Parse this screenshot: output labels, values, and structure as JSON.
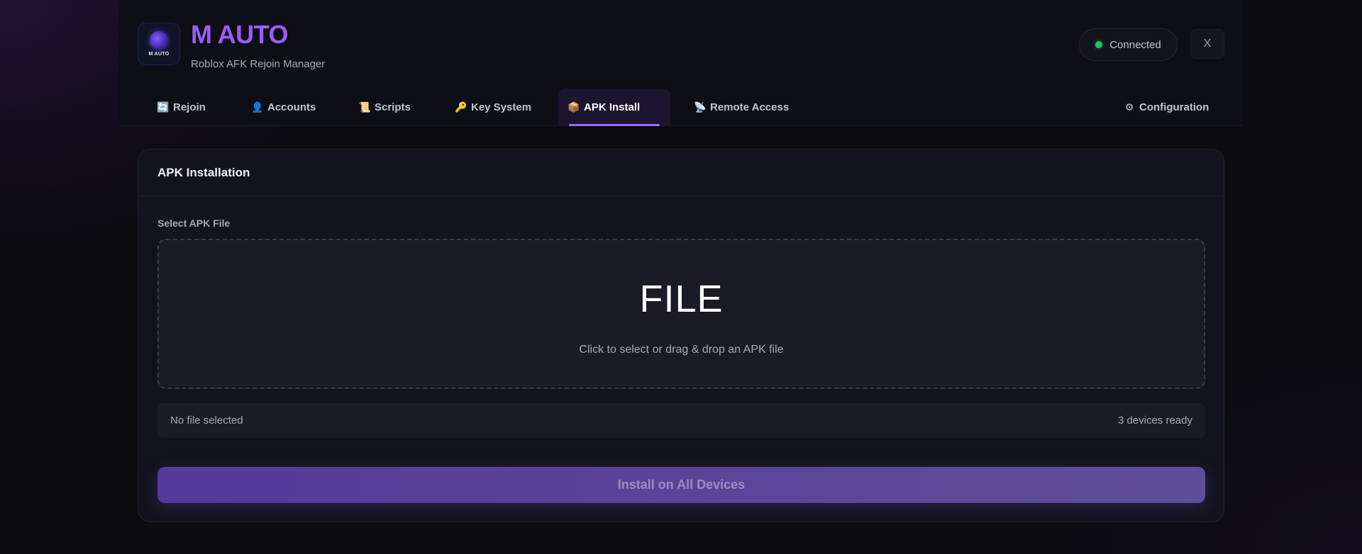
{
  "app": {
    "logo_text": "M AUTO",
    "title": "M AUTO",
    "subtitle": "Roblox AFK Rejoin Manager"
  },
  "status": {
    "label": "Connected",
    "color": "#22c55e"
  },
  "window": {
    "close_label": "X"
  },
  "tabs": [
    {
      "label": "Rejoin",
      "icon": "refresh-icon",
      "glyph": "🔄",
      "active": false
    },
    {
      "label": "Accounts",
      "icon": "user-icon",
      "glyph": "👤",
      "active": false
    },
    {
      "label": "Scripts",
      "icon": "scroll-icon",
      "glyph": "📜",
      "active": false
    },
    {
      "label": "Key System",
      "icon": "key-icon",
      "glyph": "🔑",
      "active": false
    },
    {
      "label": "APK Install",
      "icon": "package-icon",
      "glyph": "📦",
      "active": true
    },
    {
      "label": "Remote Access",
      "icon": "satellite-icon",
      "glyph": "📡",
      "active": false
    },
    {
      "label": "Configuration",
      "icon": "gear-icon",
      "glyph": "⚙",
      "active": false
    }
  ],
  "panel": {
    "title": "APK Installation",
    "field_label": "Select APK File",
    "dropzone_title": "FILE",
    "dropzone_hint": "Click to select or drag & drop an APK file",
    "file_status": "No file selected",
    "devices_status": "3 devices ready",
    "install_label": "Install on All Devices"
  },
  "colors": {
    "accent": "#9b5cf6",
    "background": "#0b0b10",
    "card": "#13131d"
  }
}
